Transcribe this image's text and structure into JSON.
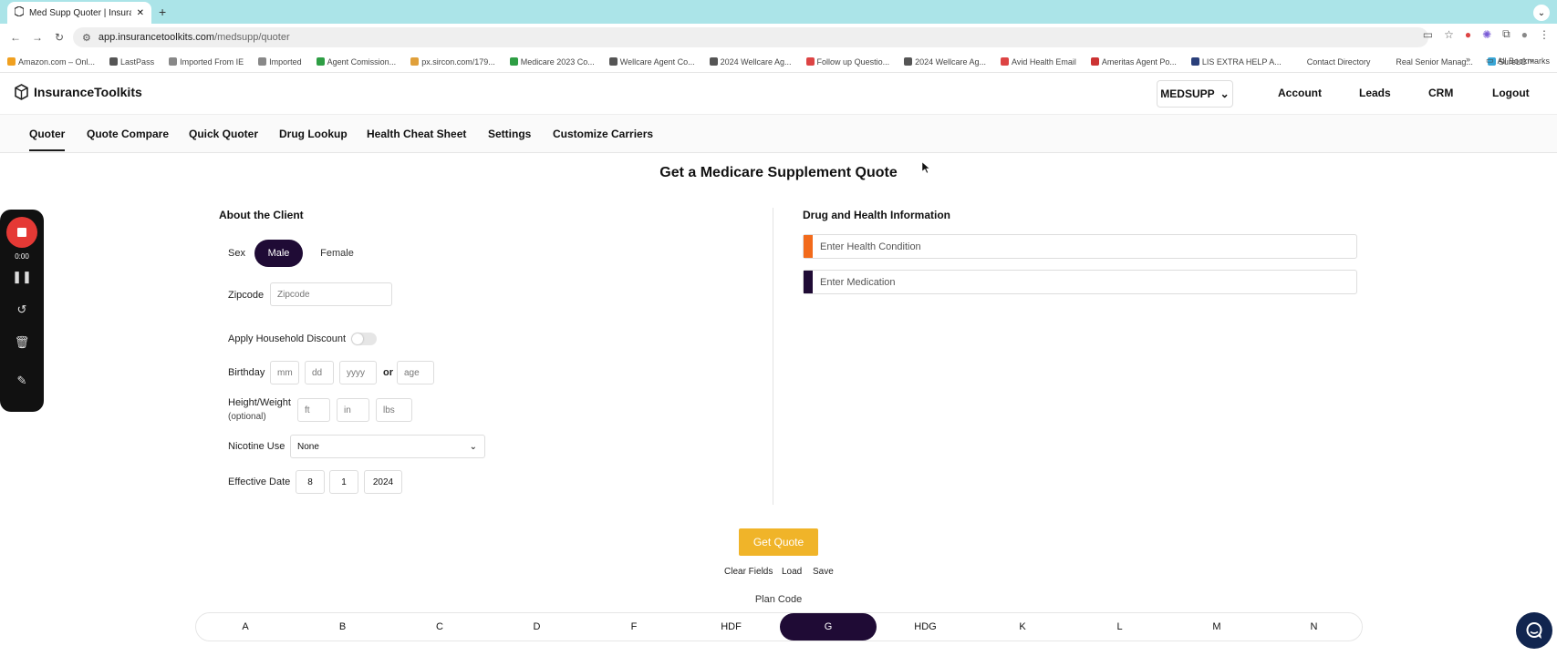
{
  "browser": {
    "tab_title": "Med Supp Quoter | Insurance",
    "url_host": "app.insurancetoolkits.com",
    "url_path": "/medsupp/quoter",
    "bookmarks": [
      {
        "label": "Amazon.com – Onl...",
        "color": "#f0a020"
      },
      {
        "label": "LastPass",
        "color": "#555"
      },
      {
        "label": "Imported From IE",
        "color": "#888"
      },
      {
        "label": "Imported",
        "color": "#888"
      },
      {
        "label": "Agent Comission...",
        "color": "#2e9e44"
      },
      {
        "label": "px.sircon.com/179...",
        "color": "#e0a03a"
      },
      {
        "label": "Medicare 2023 Co...",
        "color": "#2e9e44"
      },
      {
        "label": "Wellcare Agent Co...",
        "color": "#555"
      },
      {
        "label": "2024 Wellcare Ag...",
        "color": "#555"
      },
      {
        "label": "Follow up Questio...",
        "color": "#d44"
      },
      {
        "label": "2024 Wellcare Ag...",
        "color": "#555"
      },
      {
        "label": "Avid Health Email",
        "color": "#d44"
      },
      {
        "label": "Ameritas Agent Po...",
        "color": "#c33"
      },
      {
        "label": "LIS EXTRA HELP A...",
        "color": "#2a3f7a"
      },
      {
        "label": "Contact Directory",
        "color": "#fff"
      },
      {
        "label": "Real Senior Manag...",
        "color": "#fff"
      },
      {
        "label": "SureLC™",
        "color": "#3aa6d6"
      }
    ],
    "all_bookmarks": "All Bookmarks"
  },
  "header": {
    "brand": "InsuranceToolkits",
    "product": "MEDSUPP",
    "nav": [
      "Account",
      "Leads",
      "CRM",
      "Logout"
    ]
  },
  "subnav": [
    "Quoter",
    "Quote Compare",
    "Quick Quoter",
    "Drug Lookup",
    "Health Cheat Sheet",
    "Settings",
    "Customize Carriers"
  ],
  "recorder": {
    "time": "0:00"
  },
  "page_title": "Get a Medicare Supplement Quote",
  "client": {
    "title": "About the Client",
    "sex_label": "Sex",
    "sex_options": [
      "Male",
      "Female"
    ],
    "sex_selected": "Male",
    "zip_label": "Zipcode",
    "zip_placeholder": "Zipcode",
    "household_label": "Apply Household Discount",
    "household_on": false,
    "birthday_label": "Birthday",
    "birthday_placeholders": [
      "mm",
      "dd",
      "yyyy"
    ],
    "or": "or",
    "age_placeholder": "age",
    "hw_label": "Height/Weight",
    "hw_optional": "(optional)",
    "hw_placeholders": [
      "ft",
      "in",
      "lbs"
    ],
    "nicotine_label": "Nicotine Use",
    "nicotine_value": "None",
    "effective_label": "Effective Date",
    "effective": [
      "8",
      "1",
      "2024"
    ]
  },
  "health": {
    "title": "Drug and Health Information",
    "condition_placeholder": "Enter Health Condition",
    "medication_placeholder": "Enter Medication",
    "condition_color": "#f26a1b",
    "medication_color": "#1f0b35"
  },
  "actions": {
    "get_quote": "Get Quote",
    "clear": "Clear Fields",
    "load": "Load",
    "save": "Save",
    "accent": "#f0b429"
  },
  "plan": {
    "caption": "Plan Code",
    "codes": [
      "A",
      "B",
      "C",
      "D",
      "F",
      "HDF",
      "G",
      "HDG",
      "K",
      "L",
      "M",
      "N"
    ],
    "selected": "G"
  }
}
